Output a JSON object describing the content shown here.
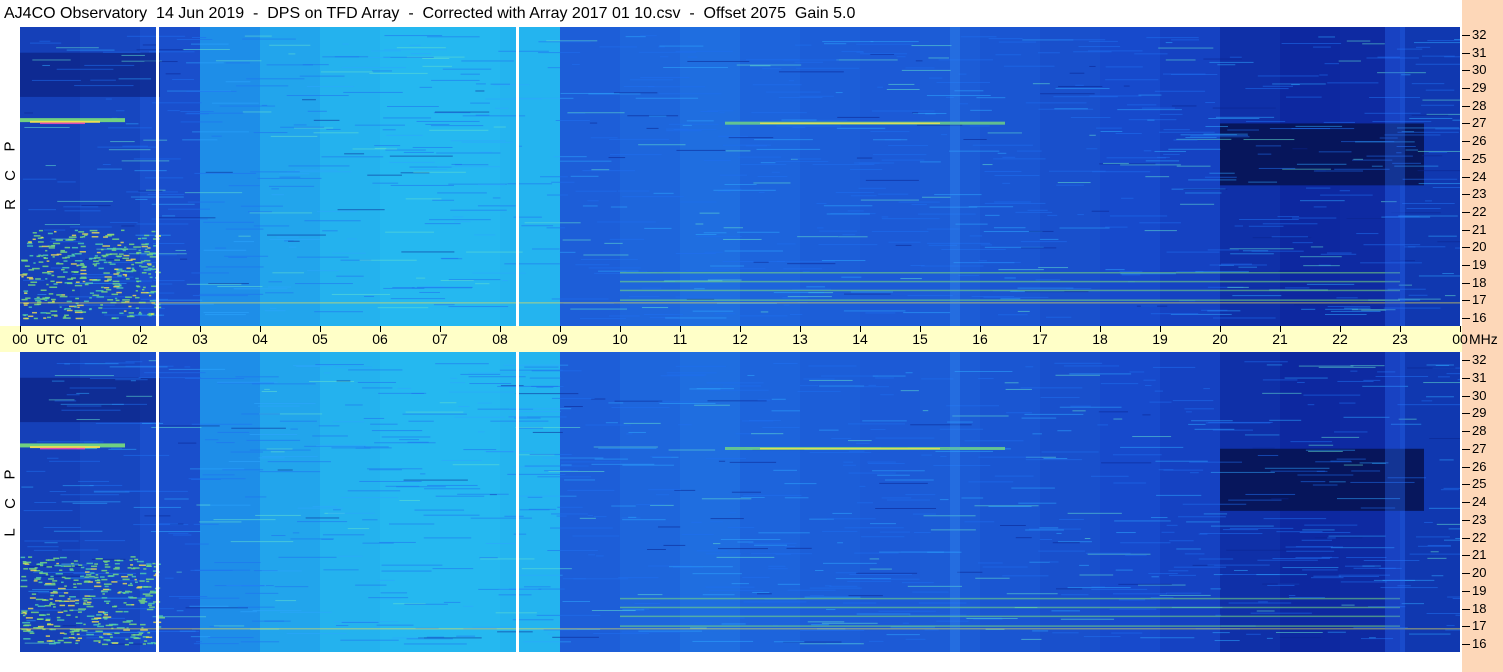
{
  "window": {
    "title": "AJ4CO Observatory  14 Jun 2019  -  DPS on TFD Array  -  Corrected with Array 2017 01 10.csv  -  Offset 2075  Gain 5.0"
  },
  "panels": {
    "top": {
      "label_letters": [
        "P",
        "C",
        "R"
      ]
    },
    "bottom": {
      "label_letters": [
        "P",
        "C",
        "L"
      ]
    }
  },
  "time_axis": {
    "utc_label": "UTC",
    "unit_label": "MHz"
  },
  "colors": {
    "background_dark": "#0a1a6e",
    "mid_blue": "#1e5fe0",
    "cyan": "#23b7f0",
    "green": "#7be07a",
    "yellow": "#f0e050",
    "magenta": "#f04fb0",
    "axis_bg": "#ffffc8",
    "freq_strip_bg": "#fdd7b8",
    "gap_marker": "#ffffff"
  },
  "chart_data": [
    {
      "type": "heatmap",
      "title": "",
      "panel": "RCP",
      "x_unit": "UTC hours",
      "y_unit": "MHz",
      "xlim": [
        0,
        24
      ],
      "ylim": [
        16,
        32
      ],
      "x_ticks": [
        "00",
        "01",
        "02",
        "03",
        "04",
        "05",
        "06",
        "07",
        "08",
        "09",
        "10",
        "11",
        "12",
        "13",
        "14",
        "15",
        "16",
        "17",
        "18",
        "19",
        "20",
        "21",
        "22",
        "23",
        "00"
      ],
      "y_ticks": [
        "16",
        "17",
        "18",
        "19",
        "20",
        "21",
        "22",
        "23",
        "24",
        "25",
        "26",
        "27",
        "28",
        "29",
        "30",
        "31",
        "32"
      ],
      "data_gaps_utc": [
        2.3,
        8.3
      ]
    },
    {
      "type": "heatmap",
      "title": "",
      "panel": "LCP",
      "x_unit": "UTC hours",
      "y_unit": "MHz",
      "xlim": [
        0,
        24
      ],
      "ylim": [
        16,
        32
      ],
      "x_ticks": [
        "00",
        "01",
        "02",
        "03",
        "04",
        "05",
        "06",
        "07",
        "08",
        "09",
        "10",
        "11",
        "12",
        "13",
        "14",
        "15",
        "16",
        "17",
        "18",
        "19",
        "20",
        "21",
        "22",
        "23",
        "00"
      ],
      "y_ticks": [
        "16",
        "17",
        "18",
        "19",
        "20",
        "21",
        "22",
        "23",
        "24",
        "25",
        "26",
        "27",
        "28",
        "29",
        "30",
        "31",
        "32"
      ],
      "data_gaps_utc": [
        2.3,
        8.3
      ]
    }
  ]
}
